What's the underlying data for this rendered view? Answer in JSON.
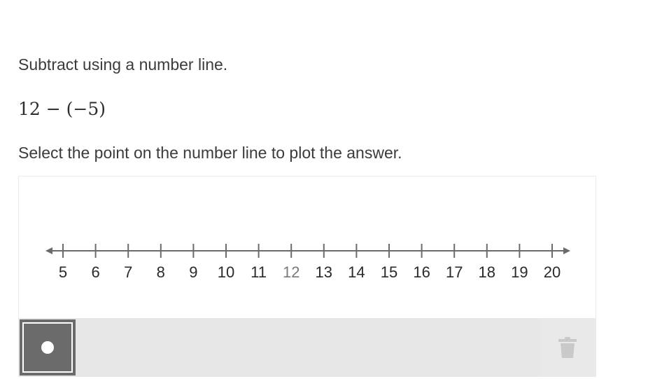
{
  "question": {
    "prompt": "Subtract using a number line.",
    "expression": "12 − (−5)",
    "instruction": "Select the point on the number line to plot the answer."
  },
  "number_line": {
    "min": 5,
    "max": 20,
    "step": 1,
    "highlighted_value": 12,
    "tick_labels": [
      "5",
      "6",
      "7",
      "8",
      "9",
      "10",
      "11",
      "12",
      "13",
      "14",
      "15",
      "16",
      "17",
      "18",
      "19",
      "20"
    ]
  },
  "toolbar": {
    "point_tool_icon": "filled-circle-icon",
    "delete_tool_icon": "trash-icon",
    "point_tool_selected": true
  },
  "colors": {
    "axis": "#6b6b6b",
    "tool_active": "#6b6b6b",
    "toolbar_bg": "#e7e7e7",
    "trash_icon": "#c9c9c9",
    "muted_label": "#7a7a7a"
  }
}
